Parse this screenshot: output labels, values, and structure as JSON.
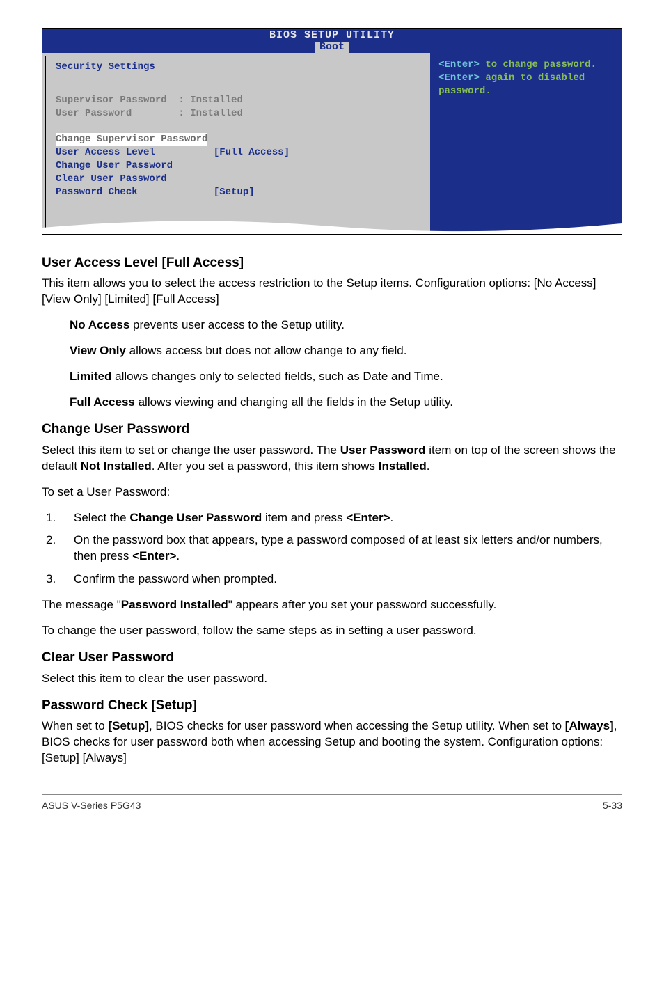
{
  "bios": {
    "headerLine1": "BIOS SETUP UTILITY",
    "headerLine2": "Boot",
    "left": {
      "title": "Security Settings",
      "row_sup": "Supervisor Password  : Installed",
      "row_usr": "User Password        : Installed",
      "row_chg_sup": "Change Supervisor Password",
      "row_ual_lbl": "User Access Level",
      "row_ual_val": "          [Full Access]",
      "row_chg_usr": "Change User Password",
      "row_clr_usr": "Clear User Password",
      "row_pwc_lbl": "Password Check",
      "row_pwc_val": "             [Setup]"
    },
    "right": {
      "text_a": "<Enter>",
      "text_b": " to change password.",
      "text_c": "<Enter>",
      "text_d": " again to disabled password."
    }
  },
  "sec_ual": {
    "heading": "User Access Level [Full Access]",
    "p1": "This item allows you to select the access restriction to the Setup items. Configuration options: [No Access] [View Only] [Limited] [Full Access]",
    "na_b": "No Access",
    "na_t": " prevents user access to the Setup utility.",
    "vo_b": "View Only",
    "vo_t": " allows access but does not allow change to any field.",
    "li_b": "Limited",
    "li_t": " allows changes only to selected fields, such as Date and Time.",
    "fa_b": "Full Access",
    "fa_t": " allows viewing and changing all the fields in the Setup utility."
  },
  "sec_cup": {
    "heading": "Change User Password",
    "p1_a": "Select this item to set or change the user password. The ",
    "p1_b": "User Password",
    "p1_c": " item on top of the screen shows the default ",
    "p1_d": "Not Installed",
    "p1_e": ". After you set a password, this item shows ",
    "p1_f": "Installed",
    "p1_g": ".",
    "p2": "To set a User Password:",
    "li1_a": "Select the ",
    "li1_b": "Change User Password",
    "li1_c": " item and press ",
    "li1_d": "<Enter>",
    "li1_e": ".",
    "li2_a": "On the password box that appears, type a password composed of at least six letters and/or numbers, then press ",
    "li2_b": "<Enter>",
    "li2_c": ".",
    "li3": "Confirm the password when prompted.",
    "p3_a": "The message \"",
    "p3_b": "Password Installed",
    "p3_c": "\" appears after you set your password successfully.",
    "p4": "To change the user password, follow the same steps as in setting a user password."
  },
  "sec_clr": {
    "heading": "Clear User Password",
    "p1": "Select this item to clear the user password."
  },
  "sec_pwc": {
    "heading": "Password Check [Setup]",
    "p1_a": "When set to ",
    "p1_b": "[Setup]",
    "p1_c": ", BIOS checks for user password when accessing the Setup utility. When set to ",
    "p1_d": "[Always]",
    "p1_e": ", BIOS checks for user password both when accessing Setup and booting the system. Configuration options: [Setup] [Always]"
  },
  "footer": {
    "left": "ASUS V-Series P5G43",
    "right": "5-33"
  }
}
